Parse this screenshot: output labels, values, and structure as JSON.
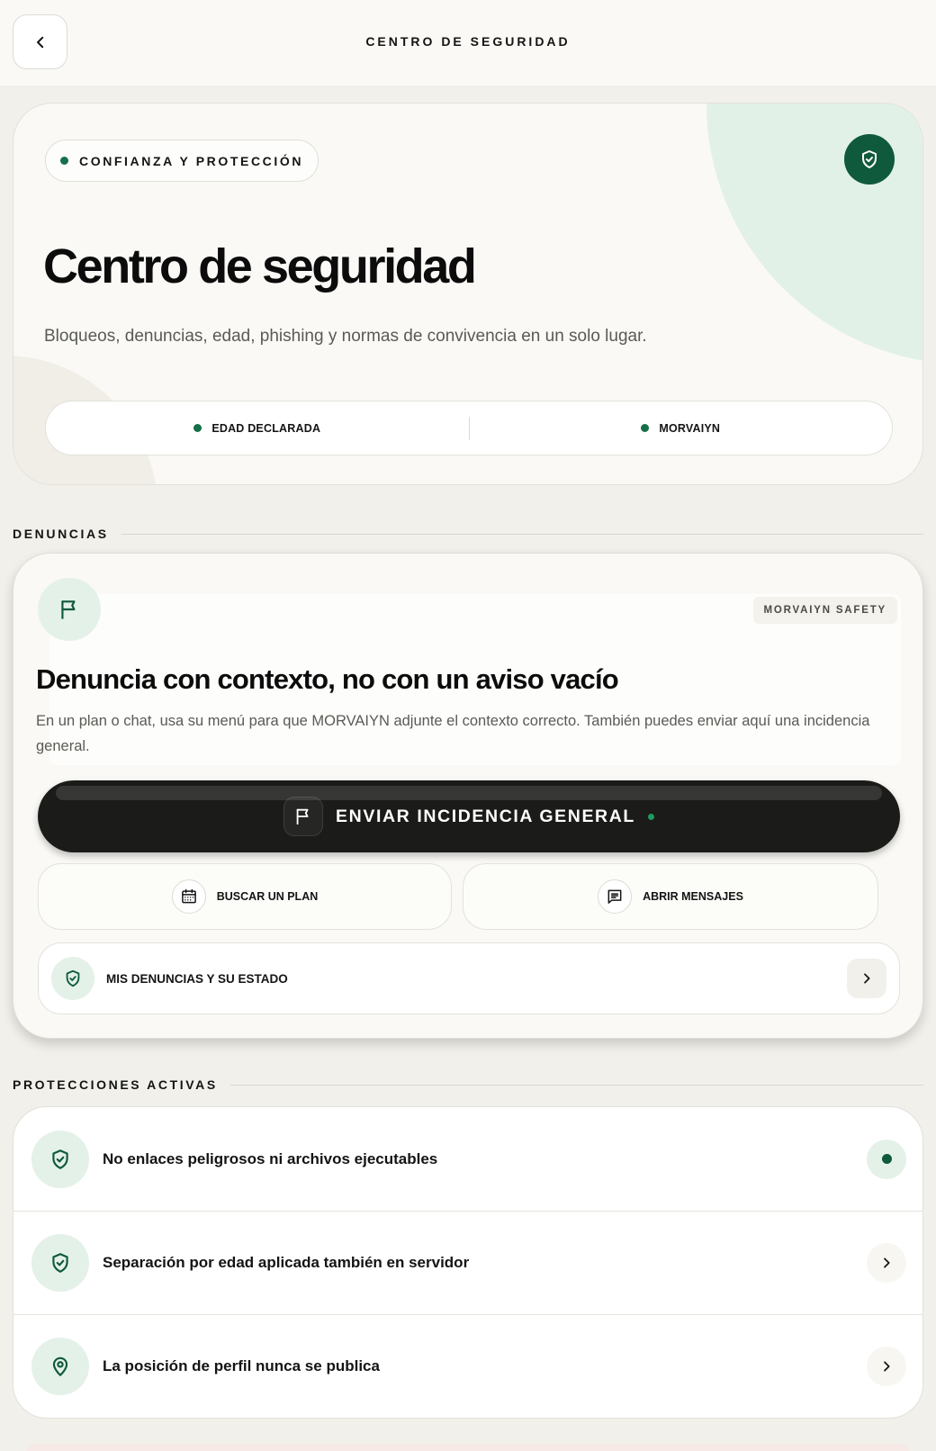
{
  "header": {
    "title": "CENTRO DE SEGURIDAD"
  },
  "hero": {
    "badge": "CONFIANZA Y PROTECCIÓN",
    "title": "Centro de seguridad",
    "subtitle": "Bloqueos, denuncias, edad, phishing y normas de convivencia en un solo lugar.",
    "status": [
      {
        "label": "EDAD DECLARADA"
      },
      {
        "label": "MORVAIYN"
      }
    ]
  },
  "reports": {
    "section_title": "DENUNCIAS",
    "tag": "MORVAIYN SAFETY",
    "title": "Denuncia con contexto, no con un aviso vacío",
    "description": "En un plan o chat, usa su menú para que MORVAIYN adjunte el contexto correcto. También puedes enviar aquí una incidencia general.",
    "primary_button": "ENVIAR INCIDENCIA GENERAL",
    "find_plan": "BUSCAR UN PLAN",
    "open_messages": "ABRIR MENSAJES",
    "my_reports": "MIS DENUNCIAS Y SU ESTADO"
  },
  "protections": {
    "section_title": "PROTECCIONES ACTIVAS",
    "items": [
      {
        "label": "No enlaces peligrosos ni archivos ejecutables",
        "icon": "shield-check-icon"
      },
      {
        "label": "Separación por edad aplicada también en servidor",
        "icon": "shield-check-icon"
      },
      {
        "label": "La posición de perfil nunca se publica",
        "icon": "map-pin-icon"
      }
    ]
  },
  "colors": {
    "accent": "#0f5a3c",
    "accent_soft": "#e4f1e8",
    "dark_button": "#1b1c1a",
    "background": "#f1f0ea"
  }
}
